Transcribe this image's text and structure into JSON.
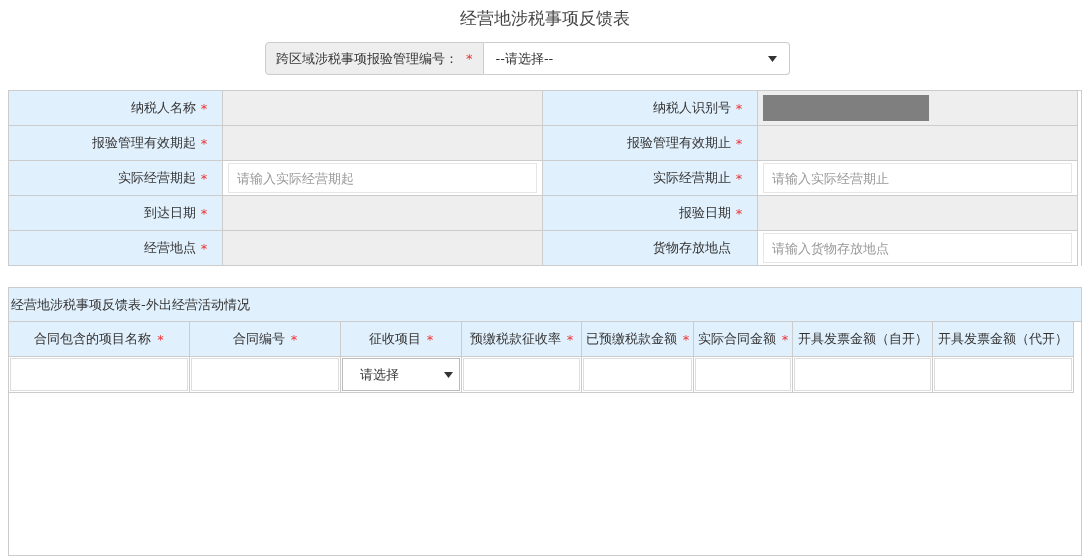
{
  "title": "经营地涉税事项反馈表",
  "selector": {
    "label": "跨区域涉税事项报验管理编号：",
    "mark": "*",
    "value": "--请选择--"
  },
  "fields": [
    {
      "label": "纳税人名称",
      "mark": "*",
      "kind": "readonly"
    },
    {
      "label": "纳税人识别号",
      "mark": "*",
      "kind": "redacted"
    },
    {
      "label": "报验管理有效期起",
      "mark": "*",
      "kind": "readonly"
    },
    {
      "label": "报验管理有效期止",
      "mark": "*",
      "kind": "readonly"
    },
    {
      "label": "实际经营期起",
      "mark": "*",
      "kind": "input",
      "placeholder": "请输入实际经营期起"
    },
    {
      "label": "实际经营期止",
      "mark": "*",
      "kind": "input",
      "placeholder": "请输入实际经营期止"
    },
    {
      "label": "到达日期",
      "mark": "*",
      "kind": "readonly"
    },
    {
      "label": "报验日期",
      "mark": "*",
      "kind": "readonly"
    },
    {
      "label": "经营地点",
      "mark": "*",
      "kind": "readonly"
    },
    {
      "label": "货物存放地点",
      "kind": "input",
      "placeholder": "请输入货物存放地点"
    }
  ],
  "section": {
    "caption": "经营地涉税事项反馈表-外出经营活动情况",
    "columns": [
      {
        "label": "合同包含的项目名称",
        "mark": "*",
        "cell": {
          "kind": "input"
        }
      },
      {
        "label": "合同编号",
        "mark": "*",
        "cell": {
          "kind": "input"
        }
      },
      {
        "label": "征收项目",
        "mark": "*",
        "cell": {
          "kind": "select",
          "value": "请选择"
        }
      },
      {
        "label": "预缴税款征收率",
        "mark": "*",
        "cell": {
          "kind": "input"
        }
      },
      {
        "label": "已预缴税款金额",
        "mark": "*",
        "cell": {
          "kind": "input"
        }
      },
      {
        "label": "实际合同金额",
        "mark": "*",
        "cell": {
          "kind": "input"
        }
      },
      {
        "label": "开具发票金额（自开）",
        "cell": {
          "kind": "input"
        }
      },
      {
        "label": "开具发票金额（代开）",
        "cell": {
          "kind": "input"
        }
      }
    ]
  }
}
